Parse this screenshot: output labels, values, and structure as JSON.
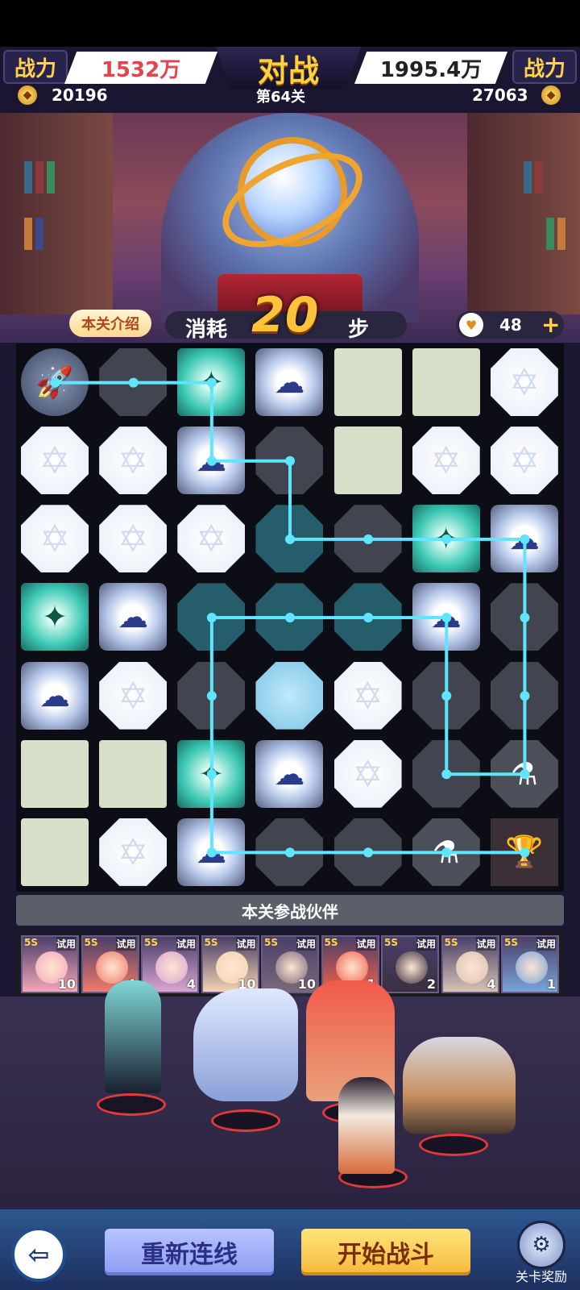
{
  "header": {
    "left_power_label": "战力",
    "left_power_value": "1532万",
    "vs_title": "对战",
    "right_power_value": "1995.4万",
    "right_power_label": "战力",
    "left_coins": "20196",
    "level": "第64关",
    "right_coins": "27063"
  },
  "info": {
    "intro_button": "本关介绍",
    "steps_prefix": "消耗",
    "steps_value": "20",
    "steps_suffix": "步",
    "energy_value": "48",
    "energy_plus": "+"
  },
  "board": {
    "rows": 7,
    "cols": 7,
    "grid": [
      [
        "rocket",
        "gray",
        "wind",
        "cloud",
        "moon",
        "moon",
        "white"
      ],
      [
        "white",
        "white",
        "cloud",
        "gray",
        "moon",
        "white",
        "white"
      ],
      [
        "white",
        "white",
        "white",
        "teal",
        "gray",
        "wind",
        "cloud"
      ],
      [
        "wind",
        "cloud",
        "teal",
        "teal",
        "teal",
        "cloud",
        "gray"
      ],
      [
        "cloud",
        "white",
        "gray",
        "lightblue",
        "white",
        "gray",
        "gray"
      ],
      [
        "moon",
        "moon",
        "wind",
        "cloud",
        "white",
        "gray",
        "bottle"
      ],
      [
        "moon",
        "white",
        "cloud",
        "gray",
        "gray",
        "bottle",
        "trophy"
      ]
    ],
    "path": [
      [
        0,
        0
      ],
      [
        0,
        1
      ],
      [
        0,
        2
      ],
      [
        1,
        2
      ],
      [
        1,
        3
      ],
      [
        2,
        3
      ],
      [
        2,
        4
      ],
      [
        2,
        5
      ],
      [
        2,
        6
      ],
      [
        3,
        6
      ],
      [
        4,
        6
      ],
      [
        5,
        6
      ],
      [
        5,
        5
      ],
      [
        4,
        5
      ],
      [
        3,
        5
      ],
      [
        3,
        4
      ],
      [
        3,
        3
      ],
      [
        3,
        2
      ],
      [
        4,
        2
      ],
      [
        5,
        2
      ],
      [
        6,
        2
      ],
      [
        6,
        3
      ],
      [
        6,
        4
      ],
      [
        6,
        5
      ],
      [
        6,
        6
      ]
    ]
  },
  "partners": {
    "title": "本关参战伙伴",
    "collapse_icon": "⌄",
    "heroes": [
      {
        "grade": "5S",
        "tag": "试用",
        "count": "10",
        "color": "#f4a6b8"
      },
      {
        "grade": "5S",
        "tag": "试用",
        "count": "4",
        "color": "#f07a6a"
      },
      {
        "grade": "5S",
        "tag": "试用",
        "count": "4",
        "color": "#d9a5d0"
      },
      {
        "grade": "5S",
        "tag": "试用",
        "count": "10",
        "color": "#f2d4b0"
      },
      {
        "grade": "5S",
        "tag": "试用",
        "count": "10",
        "color": "#7a6a7a"
      },
      {
        "grade": "5S",
        "tag": "试用",
        "count": "1",
        "color": "#f0624a"
      },
      {
        "grade": "5S",
        "tag": "试用",
        "count": "2",
        "color": "#3a3040"
      },
      {
        "grade": "5S",
        "tag": "试用",
        "count": "4",
        "color": "#d8c2b2"
      },
      {
        "grade": "5S",
        "tag": "试用",
        "count": "1",
        "color": "#7aa4d8"
      }
    ]
  },
  "buttons": {
    "back_icon": "back-arrow-icon",
    "reset": "重新连线",
    "start": "开始战斗",
    "reward_label": "关卡奖励"
  },
  "colors": {
    "path": "#5fe6ff",
    "power_left": "#e2454c",
    "gold": "#ffd24a"
  }
}
